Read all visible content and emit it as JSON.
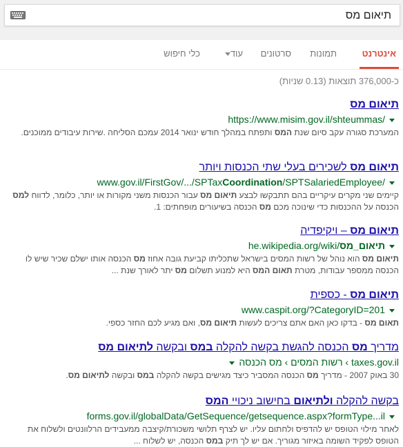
{
  "search": {
    "query": "תיאום מס"
  },
  "tabs": [
    {
      "label": "אינטרנט"
    },
    {
      "label": "תמונות"
    },
    {
      "label": "סרטונים"
    },
    {
      "label": "עוד"
    },
    {
      "label": "כלי חיפוש"
    }
  ],
  "stats": "כ-376,000 תוצאות (0.13 שניות)",
  "results": [
    {
      "title_parts": [
        "תיאום מס"
      ],
      "url": "https://www.misim.gov.il/shteummas/",
      "snippet": [
        "המערכת סגורה עקב סיום שנת ",
        "המס",
        " ותפתח במהלך חודש ינואר 2014 עמכם הסליחה .שירות עיבודים ממוכנים."
      ]
    },
    {
      "title_parts": [
        "תיאום מס",
        " לשכירים בעלי שתי הכנסות ויותר"
      ],
      "url_parts": [
        "www.gov.il/FirstGov/.../SPTax",
        "Coordination",
        "/SPTSalariedEmployee/"
      ],
      "snippet": [
        "קיימים שני מקרים עיקריים בהם תתבקשו לבצע ",
        "תיאום מס",
        " עבור הכנסות משני מקורות או יותר, כלומר, לדווח ",
        "למס",
        " הכנסה על ההכנסות כדי שינוכה מכם ",
        "מס",
        " הכנסה בשיעורים מופחתים: 1."
      ]
    },
    {
      "title_parts": [
        "תיאום מס",
        " – ויקיפדיה"
      ],
      "url_parts": [
        "he.wikipedia.org/wiki/",
        "תיאום_מס"
      ],
      "snippet": [
        "תיאום מס",
        " הוא נוהל של רשות המסים בישראל שתכליתו קביעת גובה אחוז ",
        "מס",
        " הכנסה אותו ישלם שכיר שיש לו הכנסה ממספר עבודות, מטרת ",
        "תאום המס",
        " היא למנוע תשלום ",
        "מס",
        " יתר לאורך שנת ..."
      ]
    },
    {
      "title_parts": [
        "תיאום מס",
        " - כספית"
      ],
      "url": "www.caspit.org/?CategoryID=201",
      "snippet": [
        "תאום מס",
        " - בדקו כאן האם אתם צריכים לעשות ",
        "תיאום מס",
        ", ואם מגיע לכם החזר כספי."
      ]
    },
    {
      "title_parts": [
        "מדריך ",
        "מס",
        " הכנסה להגשת בקשה להקלה ",
        "במס",
        " ובקשה ",
        "לתיאום מס"
      ],
      "url": "taxes.gov.il › רשות המסים › מס הכנסה",
      "snippet": [
        "30 באוק 2007 - מדריך ",
        "מס",
        " הכנסה המסביר כיצד מגישים בקשה להקלה ",
        "במס",
        " ובקשה ",
        "לתיאום מס",
        "."
      ]
    },
    {
      "title_parts": [
        "בקשה להקלה ",
        "ולתיאום",
        " בחישוב ניכויי ",
        "המס"
      ],
      "url": "forms.gov.il/globalData/GetSequence/getsequence.aspx?formType...il",
      "snippet": [
        "לאחר מילוי הטופס יש להדפיס ולחתום עליו. יש לצרף תלושי משכורת/קיצבה ממעבידים הרלוונטים ולשלוח את הטופס לפקיד השומה באיזור מגוריך. אם יש לך תיק ",
        "במס",
        " הכנסה, יש לשלוח ..."
      ]
    }
  ]
}
